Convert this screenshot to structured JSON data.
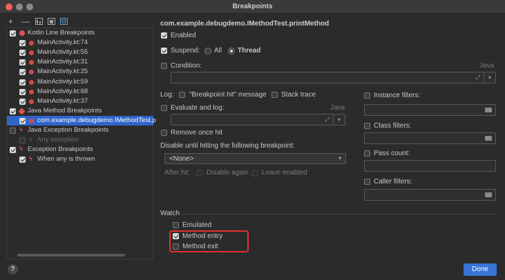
{
  "window": {
    "title": "Breakpoints"
  },
  "toolbar": {
    "add": "+",
    "remove": "—"
  },
  "tree": [
    {
      "label": "Kotlin Line Breakpoints",
      "level": 0,
      "checked": true,
      "icon": "red-dot-icon",
      "selected": false,
      "dim": false
    },
    {
      "label": "MainActivity.kt:74",
      "level": 1,
      "checked": true,
      "icon": "line-breakpoint-icon",
      "selected": false,
      "dim": false
    },
    {
      "label": "MainActivity.kt:55",
      "level": 1,
      "checked": true,
      "icon": "line-breakpoint-icon",
      "selected": false,
      "dim": false
    },
    {
      "label": "MainActivity.kt:31",
      "level": 1,
      "checked": true,
      "icon": "line-breakpoint-icon",
      "selected": false,
      "dim": false
    },
    {
      "label": "MainActivity.kt:25",
      "level": 1,
      "checked": true,
      "icon": "line-breakpoint-icon",
      "selected": false,
      "dim": false
    },
    {
      "label": "MainActivity.kt:59",
      "level": 1,
      "checked": true,
      "icon": "line-breakpoint-icon",
      "selected": false,
      "dim": false
    },
    {
      "label": "MainActivity.kt:68",
      "level": 1,
      "checked": true,
      "icon": "line-breakpoint-icon",
      "selected": false,
      "dim": false
    },
    {
      "label": "MainActivity.kt:37",
      "level": 1,
      "checked": true,
      "icon": "line-breakpoint-icon",
      "selected": false,
      "dim": false
    },
    {
      "label": "Java Method Breakpoints",
      "level": 0,
      "checked": true,
      "icon": "method-diamond-icon",
      "selected": false,
      "dim": false
    },
    {
      "label": "com.example.debugdemo.IMethodTest.p",
      "level": 1,
      "checked": true,
      "icon": "method-breakpoint-icon",
      "selected": true,
      "dim": false
    },
    {
      "label": "Java Exception Breakpoints",
      "level": 0,
      "checked": false,
      "icon": "lightning-icon",
      "selected": false,
      "dim": false
    },
    {
      "label": "Any exception",
      "level": 1,
      "checked": false,
      "icon": "lightning-icon",
      "selected": false,
      "dim": true
    },
    {
      "label": "Exception Breakpoints",
      "level": 0,
      "checked": true,
      "icon": "lightning-icon",
      "selected": false,
      "dim": false
    },
    {
      "label": "When any is thrown",
      "level": 1,
      "checked": true,
      "icon": "lightning-icon",
      "selected": false,
      "dim": false
    }
  ],
  "detail": {
    "heading": "com.example.debugdemo.IMethodTest.printMethod",
    "enabled_label": "Enabled",
    "suspend_label": "Suspend:",
    "suspend_all": "All",
    "suspend_thread": "Thread",
    "condition_label": "Condition:",
    "language": "Java",
    "log_label": "Log:",
    "log_message": "\"Breakpoint hit\" message",
    "stack_trace": "Stack trace",
    "evaluate_log": "Evaluate and log:",
    "remove_once": "Remove once hit",
    "disable_until": "Disable until hitting the following breakpoint:",
    "none_option": "<None>",
    "after_hit": "After hit:",
    "disable_again": "Disable again",
    "leave_enabled": "Leave enabled",
    "instance_filters": "Instance filters:",
    "class_filters": "Class filters:",
    "pass_count": "Pass count:",
    "caller_filters": "Caller filters:",
    "watch": "Watch",
    "emulated": "Emulated",
    "method_entry": "Method entry",
    "method_exit": "Method exit"
  },
  "footer": {
    "help": "?",
    "done": "Done"
  },
  "colors": {
    "selection": "#2f65ca",
    "accent": "#3774d6",
    "highlight": "#e53030",
    "breakpoint": "#e0524f"
  }
}
